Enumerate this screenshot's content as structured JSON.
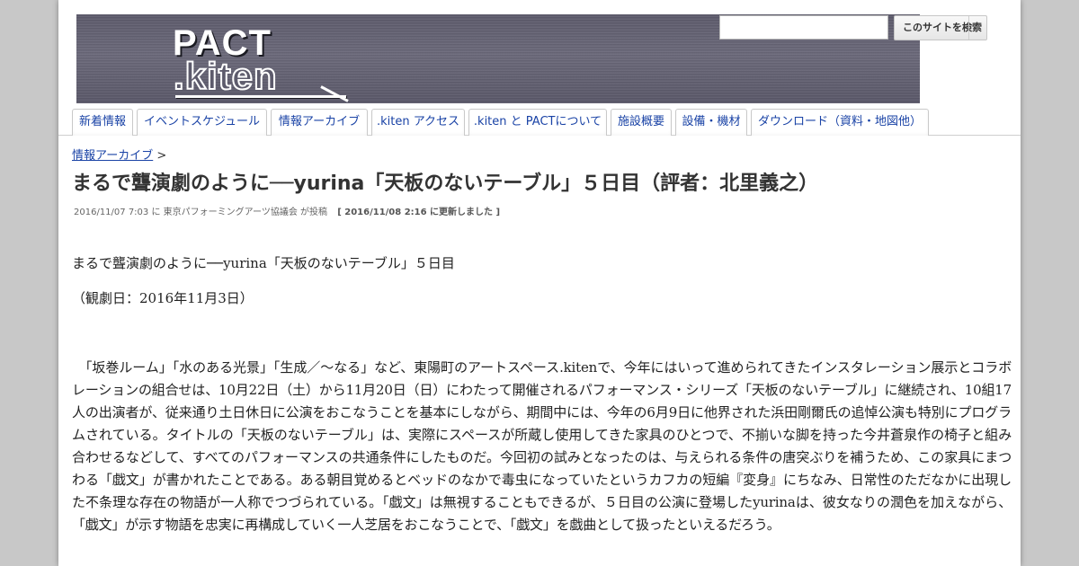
{
  "header": {
    "logo_main": "PACT",
    "logo_sub": ".kiten",
    "search_placeholder": "",
    "search_button": "このサイトを検索"
  },
  "nav": {
    "tabs": [
      {
        "label": "新着情報"
      },
      {
        "label": "イベントスケジュール"
      },
      {
        "label": "情報アーカイブ"
      },
      {
        "label": ".kiten アクセス"
      },
      {
        "label": ".kiten と PACTについて"
      },
      {
        "label": "施設概要"
      },
      {
        "label": "設備・機材"
      },
      {
        "label": "ダウンロード（資料・地図他）"
      }
    ]
  },
  "breadcrumb": {
    "link": "情報アーカイブ",
    "separator": " >"
  },
  "article": {
    "title": "まるで聾演劇のように──yurina「天板のないテーブル」５日目（評者：北里義之）",
    "meta_posted": "2016/11/07 7:03 に 東京パフォーミングアーツ協議会 が投稿",
    "meta_updated": "[ 2016/11/08 2:16 に更新しました ]",
    "para1": "まるで聾演劇のように──yurina「天板のないテーブル」５日目",
    "para2": "（観劇日：2016年11月3日）",
    "para3": "　「坂巻ルーム」「水のある光景」「生成／～なる」など、東陽町のアートスペース.kitenで、今年にはいって進められてきたインスタレーション展示とコラボレーションの組合せは、10月22日（土）から11月20日（日）にわたって開催されるパフォーマンス・シリーズ「天板のないテーブル」に継続され、10組17人の出演者が、従来通り土日休日に公演をおこなうことを基本にしながら、期間中には、今年の6月9日に他界された浜田剛爾氏の追悼公演も特別にプログラムされている。タイトルの「天板のないテーブル」は、実際にスペースが所蔵し使用してきた家具のひとつで、不揃いな脚を持った今井蒼泉作の椅子と組み合わせるなどして、すべてのパフォーマンスの共通条件にしたものだ。今回初の試みとなったのは、与えられる条件の唐突ぶりを補うため、この家具にまつわる「戯文」が書かれたことである。ある朝目覚めるとベッドのなかで毒虫になっていたというカフカの短編『変身』にちなみ、日常性のただなかに出現した不条理な存在の物語が一人称でつづられている。「戯文」は無視することもできるが、５日目の公演に登場したyurinaは、彼女なりの潤色を加えながら、「戯文」が示す物語を忠実に再構成していく一人芝居をおこなうことで、「戯文」を戯曲として扱ったといえるだろう。"
  },
  "colors": {
    "link": "#1a43a6",
    "banner": "#5d5b6c",
    "page_bg": "#c8c8c8"
  }
}
